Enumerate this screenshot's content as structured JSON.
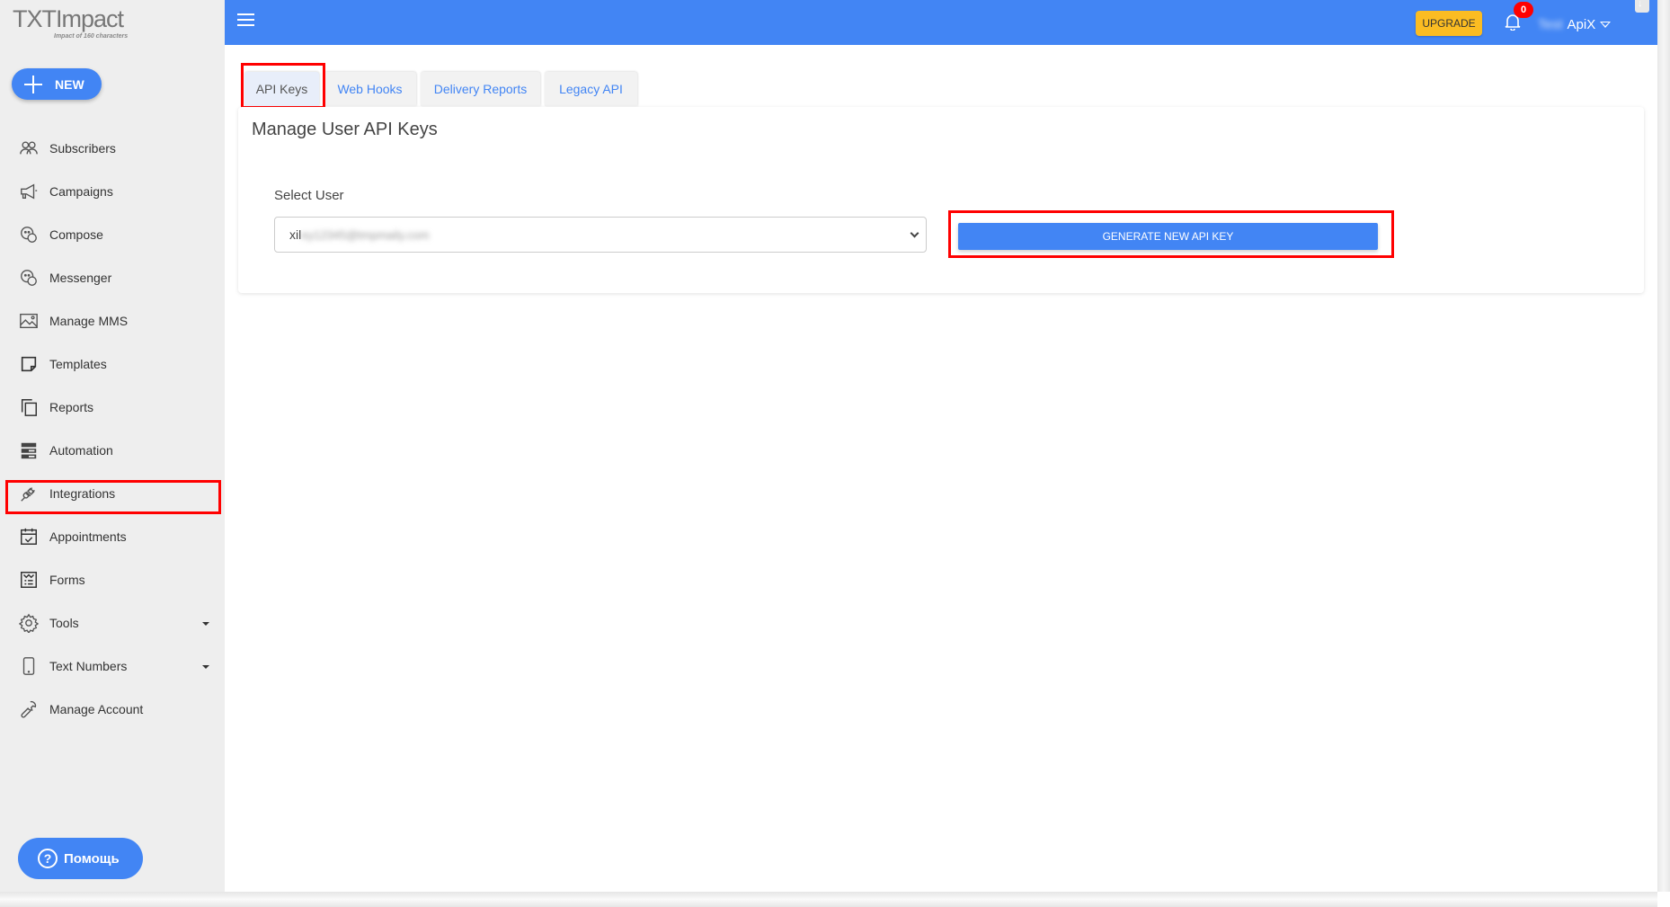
{
  "app": {
    "logo_text": "TXTImpact",
    "logo_tagline": "Impact of 160 characters"
  },
  "sidebar": {
    "new_button": "NEW",
    "items": [
      {
        "label": "Subscribers",
        "icon": "users-icon"
      },
      {
        "label": "Campaigns",
        "icon": "megaphone-icon"
      },
      {
        "label": "Compose",
        "icon": "chat-bubbles-icon"
      },
      {
        "label": "Messenger",
        "icon": "chat-bubbles-icon"
      },
      {
        "label": "Manage MMS",
        "icon": "image-icon"
      },
      {
        "label": "Templates",
        "icon": "note-icon"
      },
      {
        "label": "Reports",
        "icon": "copy-icon"
      },
      {
        "label": "Automation",
        "icon": "server-icon"
      },
      {
        "label": "Integrations",
        "icon": "plug-icon",
        "highlighted": true
      },
      {
        "label": "Appointments",
        "icon": "calendar-check-icon"
      },
      {
        "label": "Forms",
        "icon": "form-icon"
      },
      {
        "label": "Tools",
        "icon": "gear-icon",
        "has_submenu": true
      },
      {
        "label": "Text Numbers",
        "icon": "phone-icon",
        "has_submenu": true
      },
      {
        "label": "Manage Account",
        "icon": "wrench-icon"
      }
    ],
    "help_button": "Помощь"
  },
  "header": {
    "upgrade_label": "UPGRADE",
    "notification_count": "0",
    "user_name_blurred": "Test",
    "user_name": "ApiX"
  },
  "tabs": [
    {
      "label": "API Keys",
      "active": true
    },
    {
      "label": "Web Hooks",
      "active": false
    },
    {
      "label": "Delivery Reports",
      "active": false
    },
    {
      "label": "Legacy API",
      "active": false
    }
  ],
  "card": {
    "title": "Manage User API Keys",
    "select_label": "Select User",
    "select_value_visible": "xil",
    "select_value_blurred": "ey12345@tmpmaily.com",
    "generate_button": "GENERATE NEW API KEY"
  },
  "colors": {
    "primary": "#4285f4",
    "upgrade": "#fbbc22",
    "badge": "#ff0000",
    "highlight": "#ff0000",
    "sidebar_bg": "#eeeeee"
  }
}
